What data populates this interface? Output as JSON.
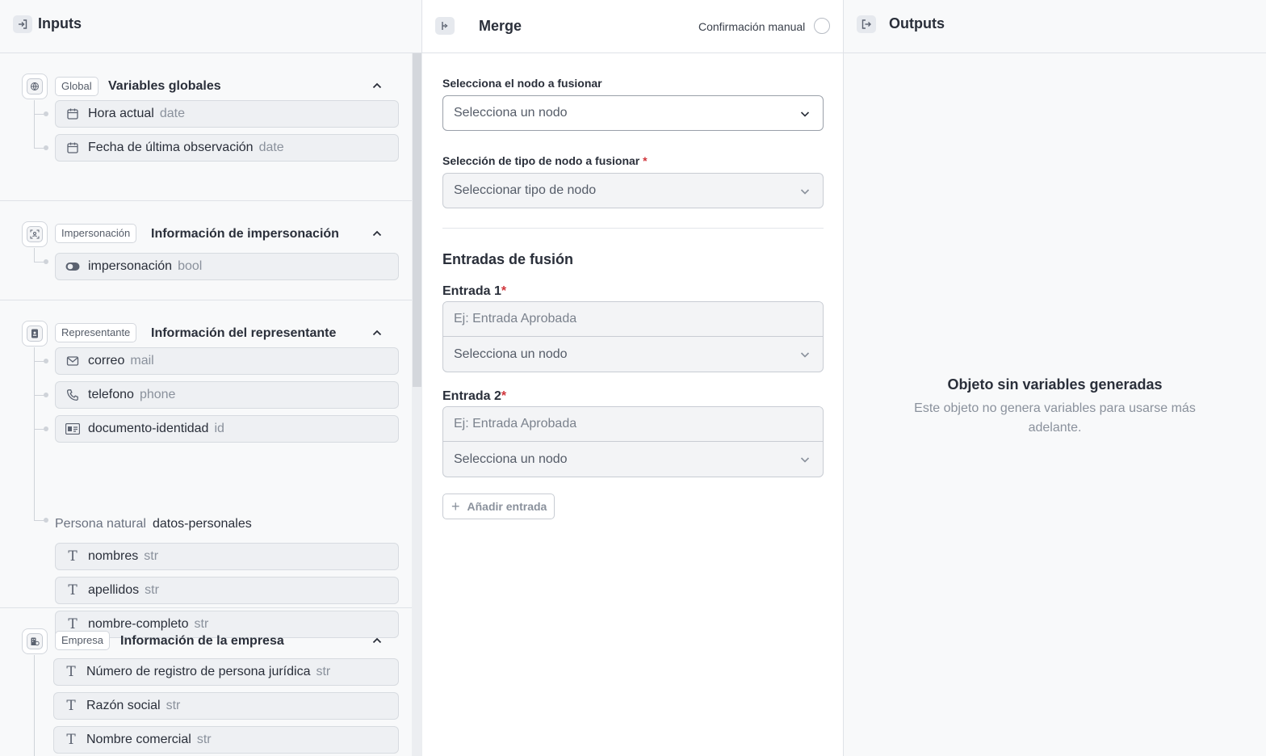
{
  "inputs": {
    "title": "Inputs",
    "sections": [
      {
        "badge": "Global",
        "title": "Variables globales",
        "icon": "globe-icon",
        "vars": [
          {
            "name": "Hora actual",
            "type": "date",
            "icon": "calendar-icon"
          },
          {
            "name": "Fecha de última observación",
            "type": "date",
            "icon": "calendar-icon"
          }
        ]
      },
      {
        "badge": "Impersonación",
        "title": "Información de impersonación",
        "icon": "face-scan-icon",
        "vars": [
          {
            "name": "impersonación",
            "type": "bool",
            "icon": "toggle-icon"
          }
        ]
      },
      {
        "badge": "Representante",
        "title": "Información del representante",
        "icon": "badge-icon",
        "vars": [
          {
            "name": "correo",
            "type": "mail",
            "icon": "mail-icon"
          },
          {
            "name": "telefono",
            "type": "phone",
            "icon": "phone-icon"
          },
          {
            "name": "documento-identidad",
            "type": "id",
            "icon": "id-card-icon"
          }
        ],
        "group": {
          "label": "Persona natural",
          "key": "datos-personales",
          "vars": [
            {
              "name": "nombres",
              "type": "str",
              "icon": "text-icon"
            },
            {
              "name": "apellidos",
              "type": "str",
              "icon": "text-icon"
            },
            {
              "name": "nombre-completo",
              "type": "str",
              "icon": "text-icon"
            }
          ]
        }
      },
      {
        "badge": "Empresa",
        "title": "Información de la empresa",
        "icon": "building-icon",
        "vars": [
          {
            "name": "Número de registro de persona jurídica",
            "type": "str",
            "icon": "text-icon"
          },
          {
            "name": "Razón social",
            "type": "str",
            "icon": "text-icon"
          },
          {
            "name": "Nombre comercial",
            "type": "str",
            "icon": "text-icon"
          }
        ]
      }
    ]
  },
  "merge": {
    "title": "Merge",
    "confirm_label": "Confirmación manual",
    "node_label": "Selecciona el nodo a fusionar",
    "node_placeholder": "Selecciona un nodo",
    "type_label": "Selección de tipo de nodo a fusionar",
    "type_placeholder": "Seleccionar tipo de nodo",
    "required_mark": "*",
    "entries_heading": "Entradas de fusión",
    "entries": [
      {
        "label": "Entrada 1",
        "input_placeholder": "Ej: Entrada Aprobada",
        "select_placeholder": "Selecciona un nodo"
      },
      {
        "label": "Entrada 2",
        "input_placeholder": "Ej: Entrada Aprobada",
        "select_placeholder": "Selecciona un nodo"
      }
    ],
    "add_entry_label": "Añadir entrada",
    "add_entry_icon": "+"
  },
  "outputs": {
    "title": "Outputs",
    "empty_title": "Objeto sin variables generadas",
    "empty_description": "Este objeto no genera variables para usarse más adelante."
  },
  "colors": {
    "panel_bg": "#f8f9fa",
    "required": "#d0343a",
    "muted_text": "#8a919c"
  }
}
